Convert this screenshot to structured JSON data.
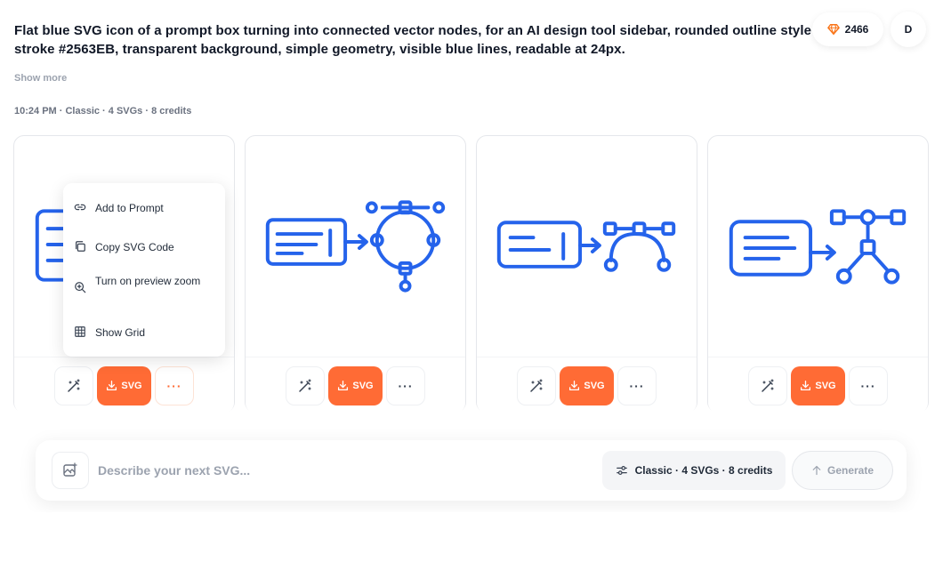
{
  "header": {
    "prompt": "Flat blue SVG icon of a prompt box turning into connected vector nodes, for an AI design tool sidebar, rounded outline style using stroke #2563EB, transparent background, simple geometry, visible blue lines, readable at 24px.",
    "show_more": "Show more",
    "meta": "10:24 PM · Classic · 4 SVGs · 8 credits",
    "credits": "2466",
    "avatar_initial": "D"
  },
  "cards": [
    {
      "download_label": "SVG"
    },
    {
      "download_label": "SVG"
    },
    {
      "download_label": "SVG"
    },
    {
      "download_label": "SVG"
    }
  ],
  "menu": {
    "items": [
      {
        "label": "Add to Prompt",
        "icon": "link-icon"
      },
      {
        "label": "Copy SVG Code",
        "icon": "copy-icon"
      },
      {
        "label": "Turn on preview zoom",
        "icon": "zoom-in-icon"
      },
      {
        "label": "Show Grid",
        "icon": "grid-icon"
      }
    ]
  },
  "composer": {
    "placeholder": "Describe your next SVG...",
    "mode": "Classic · 4 SVGs · 8 credits",
    "generate": "Generate"
  },
  "colors": {
    "icon_stroke": "#2563EB",
    "accent": "#FF6B35",
    "credits_gem": "#F97316"
  }
}
